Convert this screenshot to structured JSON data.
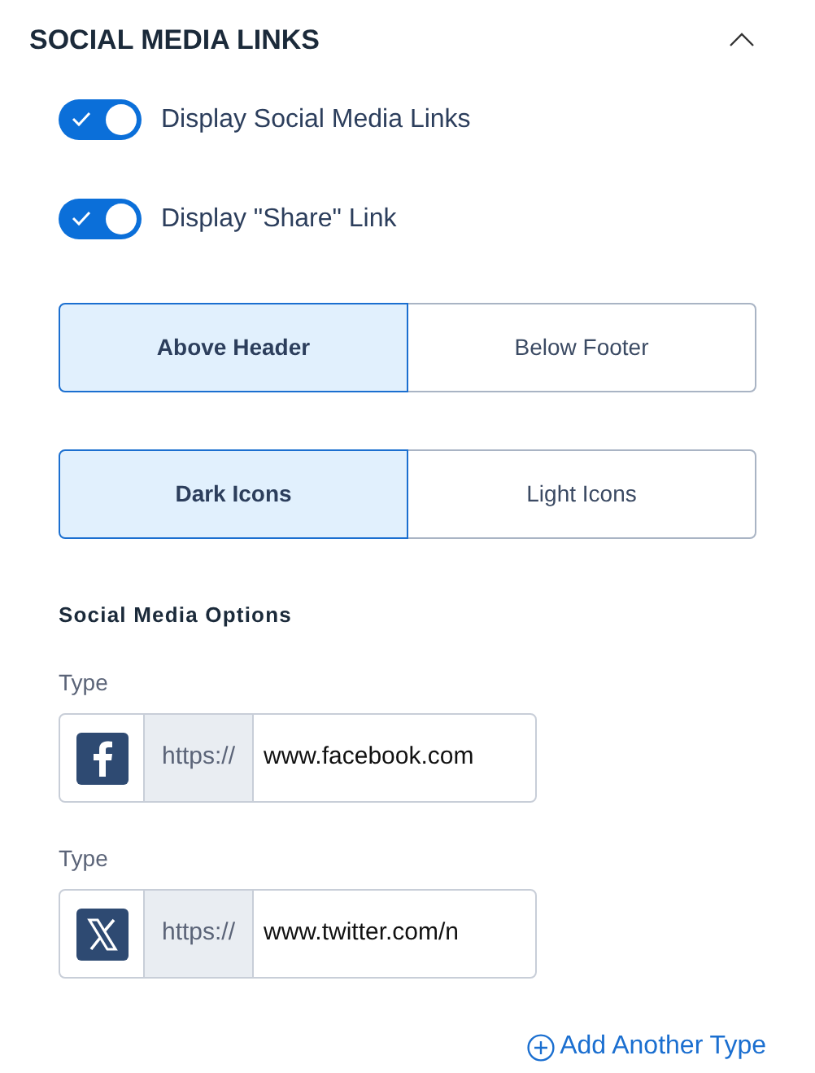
{
  "section": {
    "title": "SOCIAL MEDIA LINKS",
    "expanded": true
  },
  "toggles": [
    {
      "label": "Display Social Media Links",
      "on": true
    },
    {
      "label": "Display \"Share\" Link",
      "on": true
    }
  ],
  "segment_groups": [
    [
      {
        "label": "Above Header",
        "selected": true
      },
      {
        "label": "Below Footer",
        "selected": false
      }
    ],
    [
      {
        "label": "Dark Icons",
        "selected": true
      },
      {
        "label": "Light Icons",
        "selected": false
      }
    ]
  ],
  "options_heading": "Social Media Options",
  "links": [
    {
      "label": "Type",
      "kind": "facebook",
      "prefix": "https://",
      "value": "www.facebook.com"
    },
    {
      "label": "Type",
      "kind": "x",
      "prefix": "https://",
      "value": "www.twitter.com/n"
    }
  ],
  "add_link": "Add Another Type"
}
